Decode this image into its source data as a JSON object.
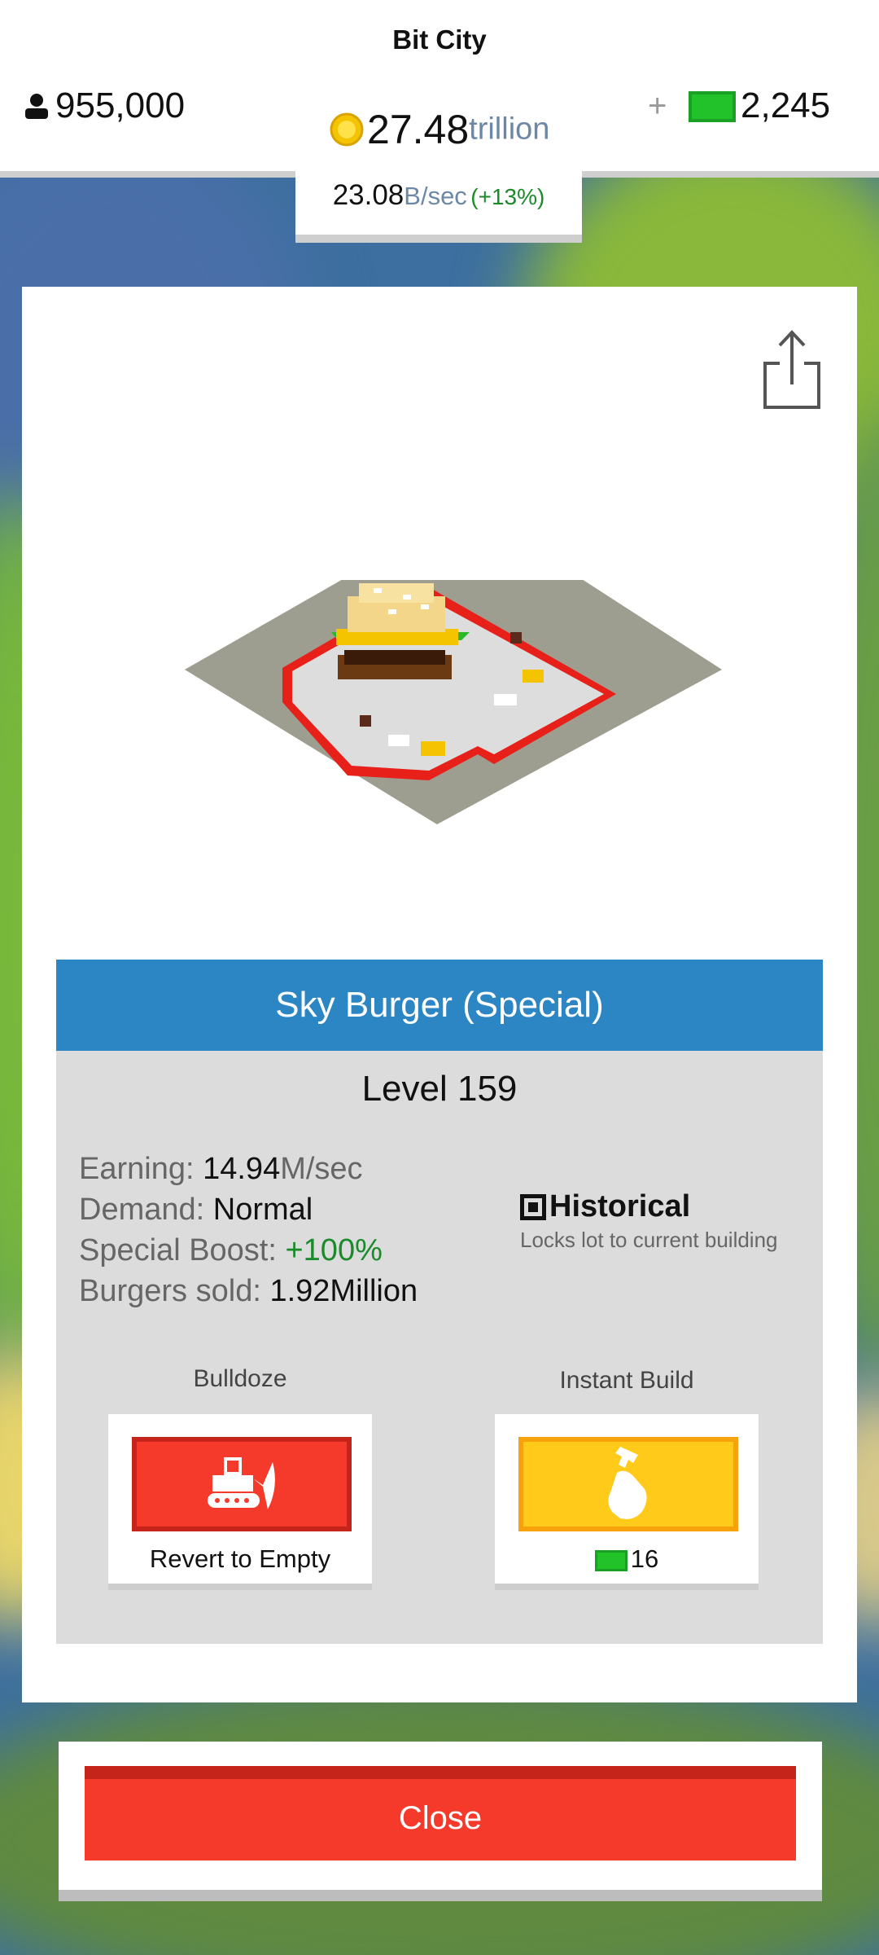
{
  "header": {
    "city_name": "Bit City",
    "population": "955,000",
    "coins_value": "27.48",
    "coins_unit": "trillion",
    "rate_value": "23.08",
    "rate_unit": "B/sec",
    "rate_bonus": "(+13%)",
    "cash_plus": "+",
    "cash_value": "2,245"
  },
  "building": {
    "title": "Sky Burger (Special)",
    "level": "Level 159",
    "stats": {
      "earning_label": "Earning:",
      "earning_value": "14.94",
      "earning_unit": "M/sec",
      "demand_label": "Demand:",
      "demand_value": "Normal",
      "boost_label": "Special Boost:",
      "boost_value": "+100%",
      "sold_label": "Burgers sold:",
      "sold_value": "1.92Million"
    },
    "historical": {
      "label": "Historical",
      "description": "Locks lot to current building",
      "checked": true
    }
  },
  "actions": {
    "bulldoze_label": "Bulldoze",
    "bulldoze_caption": "Revert to Empty",
    "instant_label": "Instant Build",
    "instant_cost": "16"
  },
  "close_label": "Close",
  "colors": {
    "header_blue": "#2d86c4",
    "close_red": "#f53a2c",
    "build_yellow": "#ffca1a",
    "cash_green": "#22c22a",
    "boost_green": "#1b8a2a"
  }
}
